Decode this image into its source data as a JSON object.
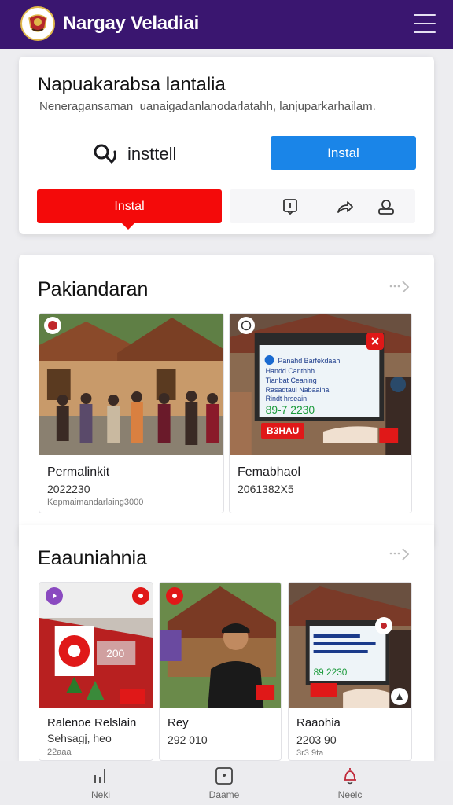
{
  "header": {
    "app_title": "Nargay Veladiai",
    "logo_icon": "emblem-icon",
    "menu_icon": "hamburger-menu-icon",
    "color": "#3a1670"
  },
  "top_card": {
    "title": "Napuakarabsa lantalia",
    "subtitle": "Neneragansaman_uanaigadanlanodarlatahh, lanjuparkarhailam.",
    "search_label": "insttell",
    "blue_button_label": "Instal",
    "red_button_label": "Instal",
    "icons": [
      "bookmark-icon",
      "share-arrow-icon",
      "account-icon"
    ],
    "accent_blue": "#1a85e8",
    "accent_red": "#f40a0a"
  },
  "section_1": {
    "title": "Pakiandaran",
    "more_icon": "chevron-right-icon",
    "items": [
      {
        "title": "Permalinkit",
        "meta": "2022230",
        "sub": "Kepmaimandarlaing3000"
      },
      {
        "title": "Femabhaol",
        "meta": "2061382X5",
        "screen_text": [
          "Panahd Barfekdaah",
          "Handd Canthhh.",
          "Tianbat Ceaning",
          "Rasadtaul Nabaaina",
          "Rindt hrseain"
        ],
        "screen_number": "89-7 2230",
        "tag": "B3HAU"
      }
    ]
  },
  "section_2": {
    "title": "Eaauniahnia",
    "more_icon": "chevron-right-icon",
    "items": [
      {
        "title": "Ralenoe Relslain",
        "meta": "Sehsagj, heo",
        "sub": "22aaa",
        "sign_number": "200"
      },
      {
        "title": "Rey",
        "meta": "292 010"
      },
      {
        "title": "Raaohia",
        "meta": "2203 90",
        "sub": "3r3 9ta",
        "screen_number": "89 2230"
      }
    ]
  },
  "bottom_nav": {
    "items": [
      {
        "label": "Neki",
        "icon": "stats-icon"
      },
      {
        "label": "Daame",
        "icon": "square-dot-icon"
      },
      {
        "label": "Neelc",
        "icon": "bell-icon"
      }
    ]
  }
}
